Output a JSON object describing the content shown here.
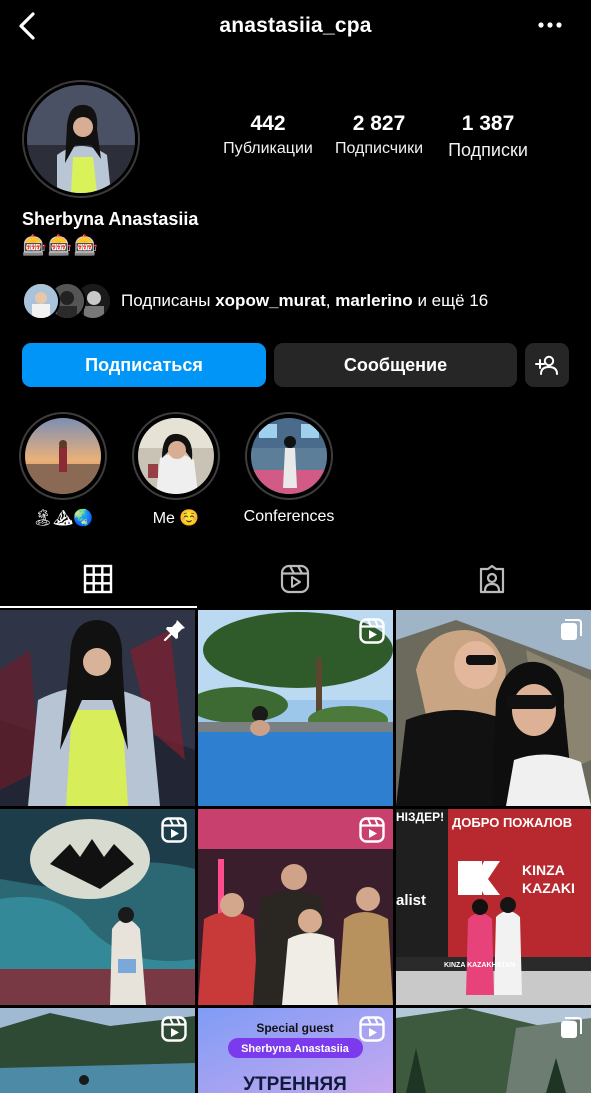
{
  "header": {
    "username": "anastasiia_cpa"
  },
  "profile": {
    "stats": [
      {
        "value": "442",
        "label": "Публикации"
      },
      {
        "value": "2 827",
        "label": "Подписчики"
      },
      {
        "value": "1 387",
        "label": "Подписки"
      }
    ],
    "full_name": "Sherbyna Anastasiia",
    "bio": "🎰🎰🎰"
  },
  "followed_by": {
    "prefix": "Подписаны",
    "user1": "xopow_murat",
    "separator": ",",
    "user2": "marlerino",
    "suffix": "и ещё 16"
  },
  "actions": {
    "follow_label": "Подписаться",
    "message_label": "Сообщение"
  },
  "highlights": [
    {
      "label": "🏝⛰🌏"
    },
    {
      "label": "Me ☺️"
    },
    {
      "label": "Conferences"
    }
  ],
  "tabs": [
    "grid",
    "reels",
    "tagged"
  ],
  "grid": {
    "posts": [
      {
        "badge": "pin-icon"
      },
      {
        "badge": "reel-icon"
      },
      {
        "badge": "carousel-icon"
      },
      {
        "badge": "reel-icon"
      },
      {
        "badge": "reel-icon"
      },
      {
        "badge": "none"
      },
      {
        "badge": "reel-icon"
      },
      {
        "badge": "reel-icon"
      },
      {
        "badge": "carousel-icon"
      }
    ],
    "post5_sign_text": "НІЗДЕР!",
    "post6_banner_1": "ДОБРО ПОЖАЛОВ",
    "post6_banner_2": "KINZA",
    "post6_banner_3": "KAZAKI",
    "post6_side_text": "alist",
    "post6_footer": "KINZA KAZAKHSTAN",
    "post8_guest": "Special guest",
    "post8_name": "Sherbyna Anastasiia",
    "post8_title": "УТРЕННЯЯ"
  },
  "colors": {
    "background": "#000000",
    "primary_button": "#0095f6",
    "secondary_button": "#262626"
  }
}
